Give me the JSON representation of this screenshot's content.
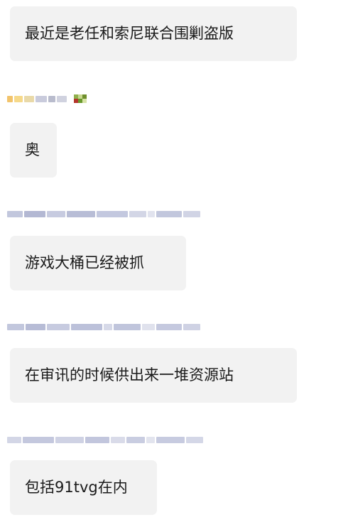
{
  "messages": [
    {
      "text": "最近是老任和索尼联合围剿盗版"
    },
    {
      "text": "奥"
    },
    {
      "text": "游戏大桶已经被抓"
    },
    {
      "text": "在审讯的时候供出来一堆资源站"
    },
    {
      "text": "包括91tvg在内"
    }
  ],
  "colors": {
    "bubble_background": "#f2f2f2",
    "text": "#1a1a1a",
    "blurred_name": "#b9bfd6"
  }
}
